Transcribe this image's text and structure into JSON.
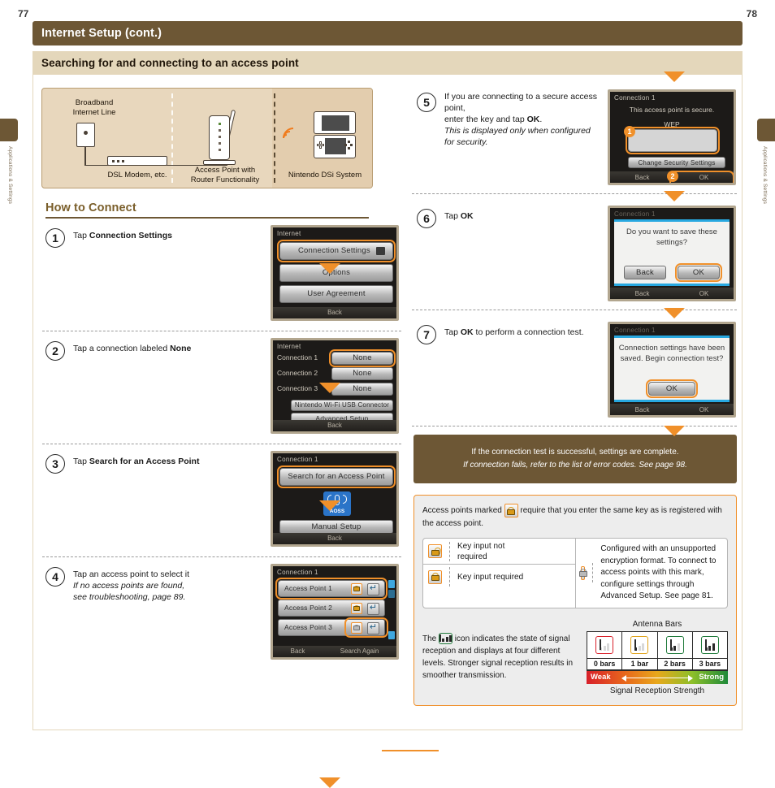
{
  "pages": {
    "left": "77",
    "right": "78"
  },
  "side_tab": {
    "label": "Applications & Settings"
  },
  "header": {
    "title": "Internet Setup (cont.)",
    "subtitle": "Searching for and connecting to an access point"
  },
  "diagram": {
    "broadband_label": "Broadband\nInternet Line",
    "broadband_line1": "Broadband",
    "broadband_line2": "Internet Line",
    "modem_label": "DSL Modem, etc.",
    "router_label_line1": "Access Point with",
    "router_label_line2": "Router Functionality",
    "dsi_label": "Nintendo DSi System"
  },
  "how_to_connect": {
    "heading": "How to Connect"
  },
  "steps": [
    {
      "num": "1",
      "text_pre": "Tap ",
      "text_bold": "Connection Settings",
      "text_post": "",
      "note": "",
      "screen": {
        "title": "Internet",
        "buttons": [
          "Connection Settings",
          "Options",
          "User Agreement"
        ],
        "footer": "Back"
      }
    },
    {
      "num": "2",
      "text_pre": "Tap a connection labeled ",
      "text_bold": "None",
      "text_post": "",
      "note": "",
      "screen": {
        "title": "Internet",
        "rows": [
          {
            "label": "Connection 1",
            "value": "None"
          },
          {
            "label": "Connection 2",
            "value": "None"
          },
          {
            "label": "Connection 3",
            "value": "None"
          }
        ],
        "extra_buttons": [
          "Nintendo Wi-Fi USB Connector",
          "Advanced Setup"
        ],
        "footer": "Back"
      }
    },
    {
      "num": "3",
      "text_pre": "Tap ",
      "text_bold": "Search for an Access Point",
      "text_post": "",
      "note": "",
      "screen": {
        "title": "Connection 1",
        "primary_button": "Search for an Access Point",
        "aoss_label": "AOSS",
        "manual_button": "Manual Setup",
        "footer": "Back"
      }
    },
    {
      "num": "4",
      "text_pre": "Tap an access point to select it",
      "text_bold": "",
      "text_post": "",
      "note_line1": "If no access points are found,",
      "note_line2": "see  troubleshooting, page 89.",
      "screen": {
        "title": "Connection 1",
        "rows": [
          "Access Point 1",
          "Access Point 2",
          "Access Point 3"
        ],
        "footer_left": "Back",
        "footer_right": "Search Again"
      }
    },
    {
      "num": "5",
      "text_line1_pre": "If you are connecting to a secure access point,",
      "text_line2_pre": "enter the key and tap ",
      "text_line2_bold": "OK",
      "text_line2_post": ".",
      "note_line1": "This is displayed only when configured",
      "note_line2": "for security.",
      "screen": {
        "title": "Connection 1",
        "message": "This access point is secure.",
        "security_type": "WEP",
        "key_value": "",
        "change_button": "Change Security Settings",
        "footer_left": "Back",
        "footer_right": "OK",
        "badge1": "1",
        "badge2": "2"
      }
    },
    {
      "num": "6",
      "text_pre": "Tap ",
      "text_bold": "OK",
      "text_post": "",
      "screen": {
        "title": "Connection 1",
        "dialog_line1": "Do you want to save these",
        "dialog_line2": "settings?",
        "buttons": [
          "Back",
          "OK"
        ],
        "footer_left": "Back",
        "footer_right": "OK"
      }
    },
    {
      "num": "7",
      "text_pre": "Tap ",
      "text_bold": "OK",
      "text_post": " to perform a connection test.",
      "screen": {
        "title": "Connection 1",
        "dialog_line1": "Connection settings have been",
        "dialog_line2": "saved. Begin connection test?",
        "buttons": [
          "OK"
        ],
        "footer_left": "Back",
        "footer_right": "OK"
      }
    }
  ],
  "notice": {
    "line1": "If the connection test is successful, settings are complete.",
    "line2": "If connection fails, refer to the list of error codes. See page 98."
  },
  "key_panel": {
    "lead_pre": "Access points marked ",
    "lead_post": " require that you enter the same key as is registered with the access point.",
    "rows": [
      {
        "icon": "lock-open-icon",
        "label_line1": "Key input not",
        "label_line2": "required"
      },
      {
        "icon": "lock-closed-icon",
        "label_line1": "Key input required",
        "label_line2": ""
      }
    ],
    "unsupported": {
      "icon": "lock-unsupported-icon",
      "line1": "Configured with an unsupported encryption",
      "line2": "format. To connect to access points with this",
      "line3": "mark, configure settings through Advanced",
      "line4": "Setup. See page 81."
    }
  },
  "antenna": {
    "text_pre": "The ",
    "text_post": " icon indicates the state of signal reception and displays at four different levels. Stronger signal reception results in smoother transmission.",
    "caption": "Antenna Bars",
    "levels": [
      {
        "label": "0 bars",
        "bars": 0,
        "tint": "#d8202a"
      },
      {
        "label": "1 bar",
        "bars": 1,
        "tint": "#e0a31c"
      },
      {
        "label": "2 bars",
        "bars": 2,
        "tint": "#1f7a3a"
      },
      {
        "label": "3 bars",
        "bars": 3,
        "tint": "#1f7a3a"
      }
    ],
    "weak_label": "Weak",
    "strong_label": "Strong",
    "footer": "Signal Reception Strength"
  },
  "colors": {
    "brand_brown": "#6d5735",
    "accent_orange": "#f0902a",
    "subtitle_bg": "#e4d7bb",
    "diagram_bg": "#e8d7bd"
  }
}
